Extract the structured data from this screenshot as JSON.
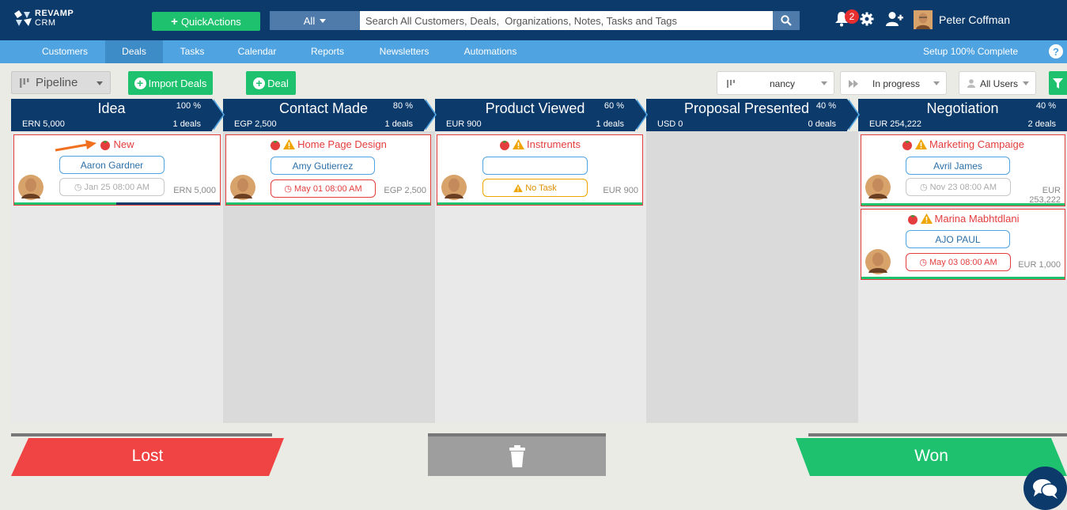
{
  "app": {
    "logo_line1": "REVAMP",
    "logo_line2": "CRM",
    "quick_actions": "QuickActions",
    "search_category": "All",
    "search_placeholder": "Search All Customers, Deals,  Organizations, Notes, Tasks and Tags",
    "notification_count": "2",
    "user_name": "Peter Coffman"
  },
  "nav": {
    "items": [
      "Customers",
      "Deals",
      "Tasks",
      "Calendar",
      "Reports",
      "Newsletters",
      "Automations"
    ],
    "active": "Deals",
    "setup_status": "Setup 100% Complete",
    "help": "?"
  },
  "toolbar": {
    "pipeline": "Pipeline",
    "import_deals": "Import Deals",
    "add_deal": "Deal",
    "owner_filter": "nancy",
    "status_filter": "In progress",
    "users_filter": "All Users"
  },
  "stages": [
    {
      "name": "Idea",
      "percent": "100 %",
      "amount": "ERN 5,000",
      "count": "1 deals"
    },
    {
      "name": "Contact Made",
      "percent": "80 %",
      "amount": "EGP 2,500",
      "count": "1 deals"
    },
    {
      "name": "Product Viewed",
      "percent": "60 %",
      "amount": "EUR 900",
      "count": "1 deals"
    },
    {
      "name": "Proposal Presented",
      "percent": "40 %",
      "amount": "USD 0",
      "count": "0 deals"
    },
    {
      "name": "Negotiation",
      "percent": "40 %",
      "amount": "EUR 254,222",
      "count": "2 deals"
    }
  ],
  "cards": [
    {
      "title": "New",
      "contact": "Aaron Gardner",
      "task": "Jan 25 08:00 AM",
      "amount": "ERN 5,000",
      "progress": 0.5
    },
    {
      "title": "Home Page Design",
      "contact": "Amy Gutierrez",
      "task": "May 01 08:00 AM",
      "amount": "EGP 2,500",
      "progress": 1.0
    },
    {
      "title": "Instruments",
      "contact": "",
      "task": "No Task",
      "amount": "EUR 900",
      "progress": 1.0
    },
    {
      "title": "Marketing Campaige",
      "contact": "Avril James",
      "task": "Nov 23 08:00 AM",
      "amount": "EUR 253,222",
      "progress": 1.0
    },
    {
      "title": "Marina Mabhtdlani",
      "contact": "AJO PAUL",
      "task": "May 03 08:00 AM",
      "amount": "EUR 1,000",
      "progress": 1.0
    }
  ],
  "dropzones": {
    "lost": "Lost",
    "won": "Won"
  },
  "colors": {
    "header": "#0b3a6b",
    "nav": "#4fa3e0",
    "green": "#1ec26e",
    "red": "#f04444",
    "warning": "#f0a400"
  }
}
